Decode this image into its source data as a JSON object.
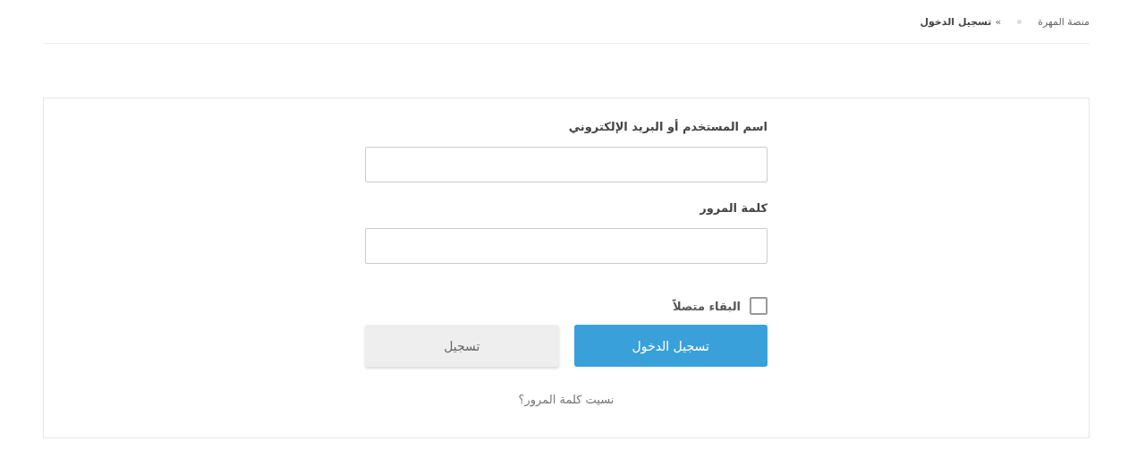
{
  "breadcrumb": {
    "items": [
      {
        "label": "منصة المهرة",
        "current": false
      },
      {
        "label": "تسجيل الدخول",
        "current": true
      }
    ],
    "arrow": "»"
  },
  "form": {
    "fields": [
      {
        "label": "اسم المستخدم أو البريد الإلكتروني"
      },
      {
        "label": "كلمة المرور"
      }
    ],
    "remember": {
      "label": "البقاء متصلاً",
      "checked": false
    },
    "buttons": [
      {
        "label": "تسجيل الدخول",
        "kind": "primary"
      },
      {
        "label": "تسجيل",
        "kind": "secondary"
      }
    ],
    "forgot_link": "نسيت كلمة المرور؟"
  }
}
